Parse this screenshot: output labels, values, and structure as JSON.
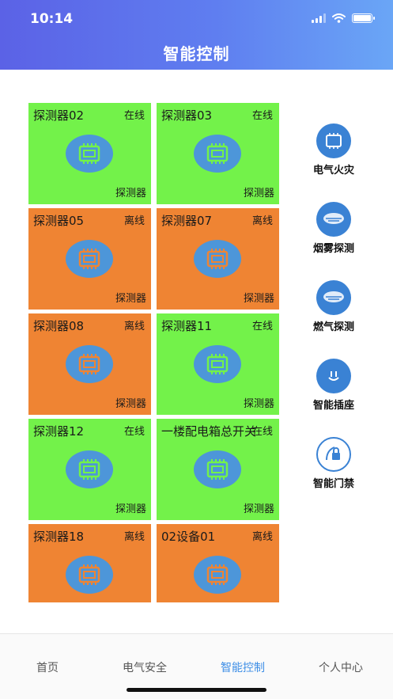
{
  "status_bar": {
    "time": "10:14"
  },
  "header": {
    "title": "智能控制"
  },
  "colors": {
    "online": "#73f24a",
    "offline": "#ef8433",
    "accent": "#3d8ee6",
    "chip": "#4d96d9"
  },
  "devices": [
    {
      "name": "探测器02",
      "status": "在线",
      "type": "探测器",
      "state": "online"
    },
    {
      "name": "探测器03",
      "status": "在线",
      "type": "探测器",
      "state": "online"
    },
    {
      "name": "探测器05",
      "status": "离线",
      "type": "探测器",
      "state": "offline"
    },
    {
      "name": "探测器07",
      "status": "离线",
      "type": "探测器",
      "state": "offline"
    },
    {
      "name": "探测器08",
      "status": "离线",
      "type": "探测器",
      "state": "offline"
    },
    {
      "name": "探测器11",
      "status": "在线",
      "type": "探测器",
      "state": "online"
    },
    {
      "name": "探测器12",
      "status": "在线",
      "type": "探测器",
      "state": "online"
    },
    {
      "name": "一楼配电箱总开关",
      "status": "在线",
      "type": "探测器",
      "state": "online"
    },
    {
      "name": "探测器18",
      "status": "离线",
      "type": "",
      "state": "offline"
    },
    {
      "name": "02设备01",
      "status": "离线",
      "type": "",
      "state": "offline"
    }
  ],
  "categories": [
    {
      "label": "电气火灾",
      "icon": "chip-icon"
    },
    {
      "label": "烟雾探测",
      "icon": "smoke-detector-icon"
    },
    {
      "label": "燃气探测",
      "icon": "gas-detector-icon"
    },
    {
      "label": "智能插座",
      "icon": "socket-icon"
    },
    {
      "label": "智能门禁",
      "icon": "door-lock-icon"
    }
  ],
  "tabs": [
    {
      "label": "首页",
      "active": false
    },
    {
      "label": "电气安全",
      "active": false
    },
    {
      "label": "智能控制",
      "active": true
    },
    {
      "label": "个人中心",
      "active": false
    }
  ]
}
